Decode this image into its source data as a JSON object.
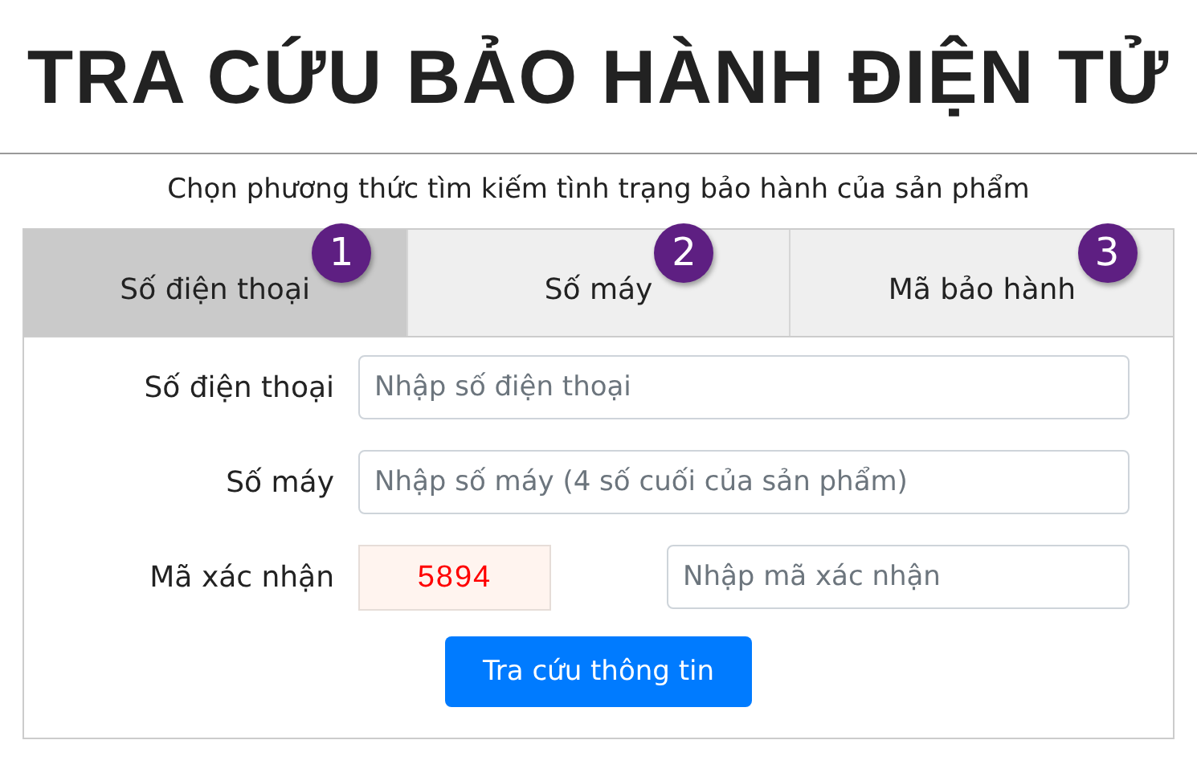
{
  "title": "TRA CỨU BẢO HÀNH ĐIỆN TỬ",
  "subtitle": "Chọn phương thức tìm kiếm tình trạng bảo hành của sản phẩm",
  "tabs": [
    {
      "label": "Số điện thoại",
      "badge": "1",
      "selected": true
    },
    {
      "label": "Số máy",
      "badge": "2",
      "selected": false
    },
    {
      "label": "Mã bảo hành",
      "badge": "3",
      "selected": false
    }
  ],
  "form": {
    "rows": [
      {
        "kind": "input",
        "label": "Số điện thoại",
        "placeholder": "Nhập số điện thoại"
      },
      {
        "kind": "input",
        "label": "Số máy",
        "placeholder": "Nhập số máy (4 số cuối của sản phẩm)"
      },
      {
        "kind": "captcha",
        "label": "Mã xác nhận",
        "code": "5894",
        "placeholder": "Nhập mã xác nhận"
      }
    ],
    "submit": "Tra cứu thông tin"
  }
}
